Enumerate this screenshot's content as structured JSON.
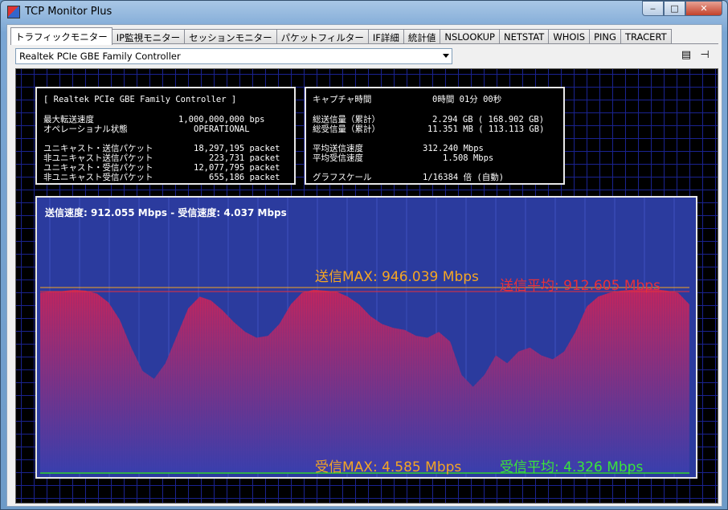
{
  "window": {
    "title": "TCP Monitor Plus",
    "min": "‒",
    "max": "□",
    "close": "✕"
  },
  "tabs": [
    {
      "label": "トラフィックモニター",
      "active": true
    },
    {
      "label": "IP監視モニター"
    },
    {
      "label": "セッションモニター"
    },
    {
      "label": "パケットフィルター"
    },
    {
      "label": "IF詳細"
    },
    {
      "label": "統計値"
    },
    {
      "label": "NSLOOKUP"
    },
    {
      "label": "NETSTAT"
    },
    {
      "label": "WHOIS"
    },
    {
      "label": "PING"
    },
    {
      "label": "TRACERT"
    }
  ],
  "adapter": {
    "selected": "Realtek PCIe GBE Family Controller"
  },
  "toolbar": {
    "list_icon": "list-icon",
    "pin_icon": "pin-icon"
  },
  "info_left": {
    "header": "[ Realtek PCIe GBE Family Controller ]",
    "max_speed_label": "最大転送速度",
    "max_speed_value": "1,000,000,000 bps",
    "op_state_label": "オペレーショナル状態",
    "op_state_value": "OPERATIONAL",
    "uc_send_label": "ユニキャスト・送信パケット",
    "uc_send_value": "18,297,195 packet",
    "nuc_send_label": "非ユニキャスト送信パケット",
    "nuc_send_value": "223,731 packet",
    "uc_recv_label": "ユニキャスト・受信パケット",
    "uc_recv_value": "12,077,795 packet",
    "nuc_recv_label": "非ユニキャスト受信パケット",
    "nuc_recv_value": "655,186 packet"
  },
  "info_right": {
    "capture_label": "キャプチャ時間",
    "capture_value": "0時間 01分 00秒",
    "total_send_label": "総送信量（累計）",
    "total_send_value": "2.294 GB ( 168.902 GB)",
    "total_recv_label": "総受信量（累計）",
    "total_recv_value": "11.351 MB ( 113.113 GB)",
    "avg_send_label": "平均送信速度",
    "avg_send_value": "312.240 Mbps",
    "avg_recv_label": "平均受信速度",
    "avg_recv_value": "1.508 Mbps",
    "scale_label": "グラフスケール",
    "scale_value": "1/16384 倍 (自動)"
  },
  "graph": {
    "current_rates": "送信速度: 912.055 Mbps  -  受信速度:   4.037 Mbps",
    "send_max": "送信MAX: 946.039 Mbps",
    "send_avg": "送信平均: 912.605 Mbps",
    "recv_max": "受信MAX:   4.585 Mbps",
    "recv_avg": "受信平均:   4.326 Mbps",
    "colors": {
      "send_fill": "#c8245a",
      "bg": "#2b3b9e",
      "recv_line": "#2fd32f",
      "max_text": "#f5a623",
      "avg_text": "#e8303a",
      "recv_avg_text": "#39e639"
    },
    "send_series_mbps": [
      920,
      925,
      928,
      935,
      930,
      915,
      870,
      780,
      640,
      520,
      480,
      560,
      700,
      840,
      900,
      880,
      830,
      770,
      720,
      690,
      700,
      760,
      860,
      920,
      935,
      930,
      925,
      900,
      860,
      800,
      760,
      740,
      730,
      700,
      690,
      720,
      670,
      500,
      440,
      500,
      600,
      560,
      620,
      640,
      600,
      580,
      620,
      720,
      850,
      900,
      920,
      930,
      935,
      940,
      938,
      930,
      920,
      860
    ],
    "max_mbps": 946.039
  }
}
